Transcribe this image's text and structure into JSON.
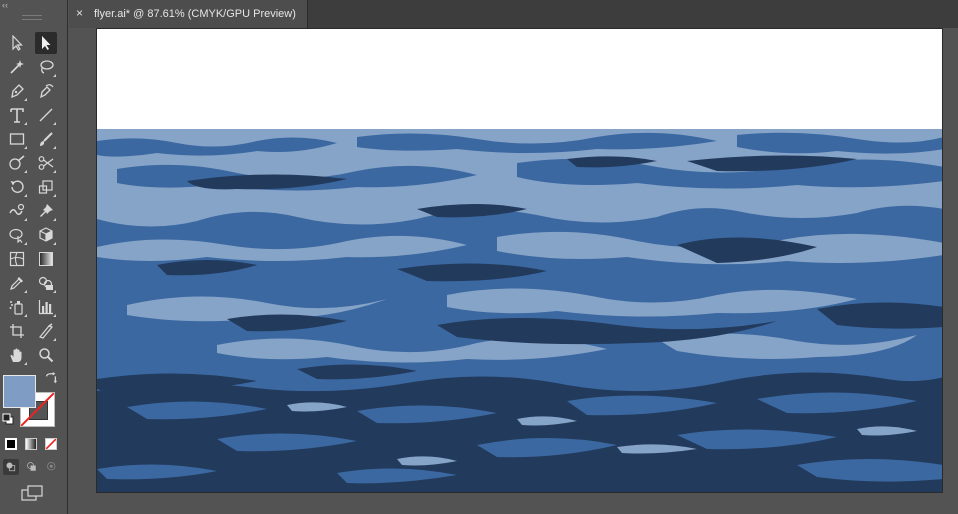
{
  "document": {
    "tab_title": "flyer.ai* @ 87.61% (CMYK/GPU Preview)",
    "close_label": "×"
  },
  "toolbar": {
    "collapse_label": "‹‹",
    "tools": [
      {
        "name": "selection-tool",
        "icon": "arrow-outline-icon",
        "active": false
      },
      {
        "name": "direct-selection-tool",
        "icon": "arrow-filled-icon",
        "active": true
      },
      {
        "name": "magic-wand-tool",
        "icon": "magic-wand-icon",
        "active": false
      },
      {
        "name": "lasso-tool",
        "icon": "lasso-icon",
        "active": false
      },
      {
        "name": "pen-tool",
        "icon": "pen-icon",
        "active": false
      },
      {
        "name": "curvature-tool",
        "icon": "curvature-pen-icon",
        "active": false
      },
      {
        "name": "type-tool",
        "icon": "type-icon",
        "active": false
      },
      {
        "name": "line-segment-tool",
        "icon": "line-icon",
        "active": false
      },
      {
        "name": "rectangle-tool",
        "icon": "rectangle-icon",
        "active": false
      },
      {
        "name": "paintbrush-tool",
        "icon": "brush-icon",
        "active": false
      },
      {
        "name": "shaper-tool",
        "icon": "shaper-icon",
        "active": false
      },
      {
        "name": "scissors-tool",
        "icon": "scissors-icon",
        "active": false
      },
      {
        "name": "rotate-tool",
        "icon": "rotate-icon",
        "active": false
      },
      {
        "name": "scale-tool",
        "icon": "scale-icon",
        "active": false
      },
      {
        "name": "warp-tool",
        "icon": "warp-icon",
        "active": false
      },
      {
        "name": "puppet-warp-tool",
        "icon": "pin-icon",
        "active": false
      },
      {
        "name": "shape-builder-tool",
        "icon": "shape-builder-icon",
        "active": false
      },
      {
        "name": "perspective-grid-tool",
        "icon": "cube-icon",
        "active": false
      },
      {
        "name": "mesh-tool",
        "icon": "mesh-icon",
        "active": false
      },
      {
        "name": "gradient-tool",
        "icon": "gradient-icon",
        "active": false
      },
      {
        "name": "eyedropper-tool",
        "icon": "eyedropper-icon",
        "active": false
      },
      {
        "name": "blend-tool",
        "icon": "blend-icon",
        "active": false
      },
      {
        "name": "symbol-sprayer-tool",
        "icon": "sprayer-icon",
        "active": false
      },
      {
        "name": "column-graph-tool",
        "icon": "bar-graph-icon",
        "active": false
      },
      {
        "name": "artboard-tool",
        "icon": "artboard-icon",
        "active": false
      },
      {
        "name": "slice-tool",
        "icon": "knife-icon",
        "active": false
      },
      {
        "name": "hand-tool",
        "icon": "hand-icon",
        "active": false
      },
      {
        "name": "zoom-tool",
        "icon": "magnifier-icon",
        "active": false
      }
    ],
    "fill_color": "#7f9dc4",
    "stroke": "none"
  },
  "artwork": {
    "sky_color": "#ffffff",
    "ocean_colors": {
      "dark": "#223a5c",
      "mid": "#3b68a0",
      "light": "#86a3c8"
    }
  }
}
